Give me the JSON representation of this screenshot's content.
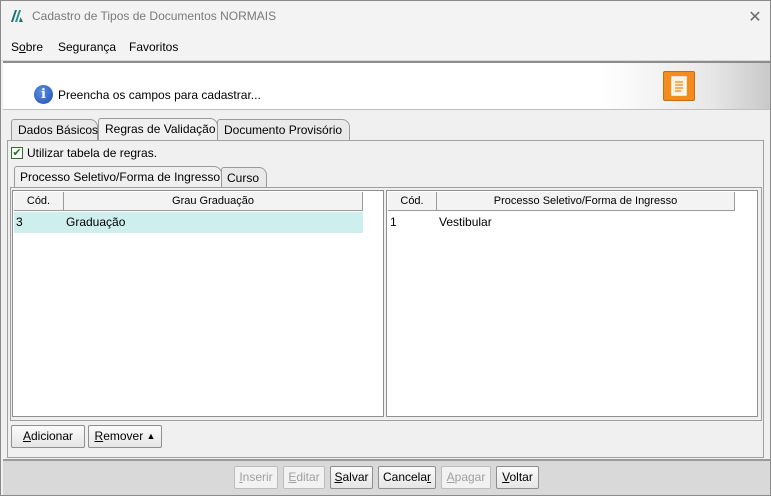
{
  "window": {
    "title": "Cadastro de Tipos de Documentos NORMAIS",
    "close_glyph": "✕"
  },
  "menu": {
    "items": [
      {
        "pre": "S",
        "u": "o",
        "post": "bre"
      },
      {
        "pre": "",
        "u": "",
        "post": "Segurança"
      },
      {
        "pre": "",
        "u": "",
        "post": "Favoritos"
      }
    ]
  },
  "header": {
    "info_icon_glyph": "i",
    "message": "Preencha os campos para cadastrar..."
  },
  "tabs": [
    {
      "label": "Dados Básicos"
    },
    {
      "label": "Regras de Validação"
    },
    {
      "label": "Documento Provisório"
    }
  ],
  "rules": {
    "checkbox_checked": true,
    "checkbox_glyph": "✔",
    "checkbox_label": "Utilizar tabela de regras."
  },
  "subtabs": [
    {
      "label": "Processo Seletivo/Forma de Ingresso"
    },
    {
      "label": "Curso"
    }
  ],
  "left_table": {
    "columns": [
      "Cód.",
      "Grau Graduação"
    ],
    "rows": [
      {
        "code": "3",
        "name": "Graduação"
      }
    ]
  },
  "right_table": {
    "columns": [
      "Cód.",
      "Processo Seletivo/Forma de Ingresso"
    ],
    "rows": [
      {
        "code": "1",
        "name": "Vestibular"
      }
    ]
  },
  "actions": {
    "add": {
      "u": "A",
      "rest": "dicionar"
    },
    "remove": {
      "u": "R",
      "rest": "emover",
      "arrow": "▲"
    }
  },
  "footer": {
    "inserir": {
      "u": "I",
      "rest": "nserir"
    },
    "editar": {
      "u": "E",
      "rest": "ditar"
    },
    "salvar": {
      "u": "S",
      "rest": "alvar"
    },
    "cancelar": {
      "pre": "Cancela",
      "u": "r"
    },
    "apagar": {
      "u": "A",
      "rest": "pagar"
    },
    "voltar": {
      "u": "V",
      "rest": "oltar"
    }
  },
  "colors": {
    "selected_row": "#cfeeee",
    "accent_orange": "#f28c1f",
    "check_green": "#1b7a1b"
  }
}
